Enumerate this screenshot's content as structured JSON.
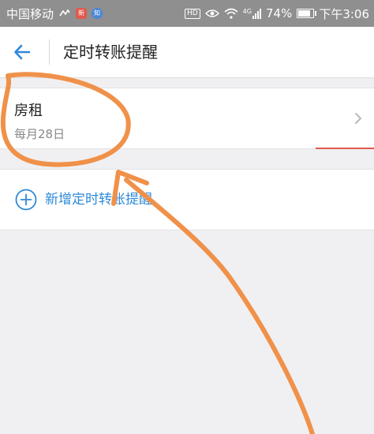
{
  "status_bar": {
    "carrier": "中国移动",
    "notification_badge_1": "新",
    "notification_badge_2": "知",
    "hd_label": "HD",
    "network_label": "4G",
    "battery": "74%",
    "battery_level": 0.74,
    "time": "下午3:06"
  },
  "header": {
    "title": "定时转账提醒",
    "back_icon": "arrow-left-icon"
  },
  "reminders": [
    {
      "title": "房租",
      "schedule": "每月28日",
      "chevron_icon": "chevron-right-icon"
    }
  ],
  "add_action": {
    "label": "新增定时转账提醒",
    "icon": "plus-circle-icon"
  },
  "colors": {
    "accent": "#2f8ad8",
    "annotation": "#f0914a",
    "status_bar_bg": "#8f8f8f",
    "page_bg": "#f0f0f2"
  }
}
